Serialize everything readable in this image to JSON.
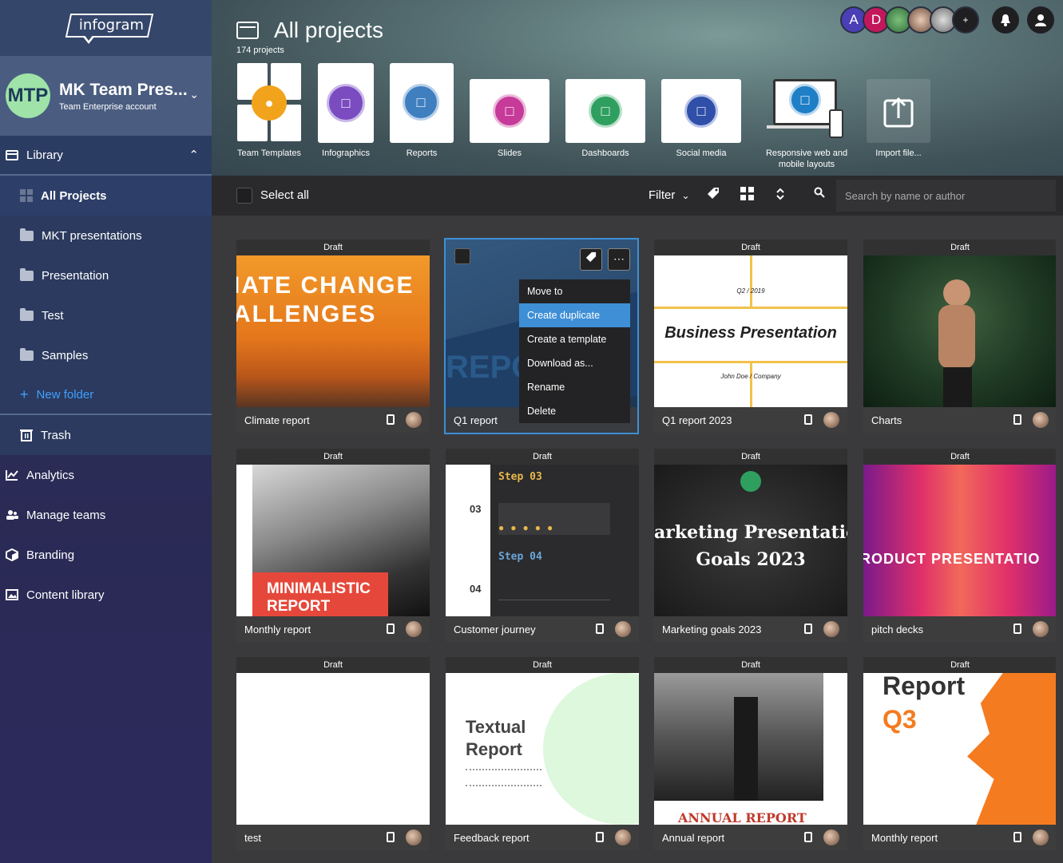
{
  "brand": {
    "logo_text": "infogram"
  },
  "team": {
    "initials": "MTP",
    "name": "MK Team Pres...",
    "account_type": "Team Enterprise account"
  },
  "sidebar": {
    "library_label": "Library",
    "library_items": [
      {
        "label": "All Projects"
      },
      {
        "label": "MKT presentations"
      },
      {
        "label": "Presentation"
      },
      {
        "label": "Test"
      },
      {
        "label": "Samples"
      }
    ],
    "new_folder_label": "New folder",
    "trash_label": "Trash",
    "main_items": [
      {
        "label": "Analytics"
      },
      {
        "label": "Manage teams"
      },
      {
        "label": "Branding"
      },
      {
        "label": "Content library"
      }
    ]
  },
  "header": {
    "title": "All projects",
    "count": "174 projects",
    "templates": [
      {
        "label": "Team Templates"
      },
      {
        "label": "Infographics"
      },
      {
        "label": "Reports"
      },
      {
        "label": "Slides"
      },
      {
        "label": "Dashboards"
      },
      {
        "label": "Social media"
      },
      {
        "label": "Responsive web and mobile layouts"
      },
      {
        "label": "Import file..."
      }
    ],
    "users": [
      {
        "initial": "A",
        "color": "#4a3fb6"
      },
      {
        "initial": "D",
        "color": "#c2185b"
      }
    ]
  },
  "toolbar": {
    "select_all": "Select all",
    "filter": "Filter",
    "search_placeholder": "Search by name or author"
  },
  "projects": [
    {
      "status": "Draft",
      "title": "Climate report",
      "thumb_text": "IATE CHANGE ALLENGES"
    },
    {
      "status": "",
      "title": "Q1 report",
      "thumb_text": "REPOR"
    },
    {
      "status": "Draft",
      "title": "Q1 report 2023",
      "thumb_text": "Business Presentation",
      "thumb_sub1": "Q2 / 2019",
      "thumb_sub2": "John Doe / Company"
    },
    {
      "status": "Draft",
      "title": "Charts",
      "thumb_text": ""
    },
    {
      "status": "Draft",
      "title": "Monthly report",
      "thumb_text": "MINIMALISTIC REPORT"
    },
    {
      "status": "Draft",
      "title": "Customer journey",
      "thumb_text": "Step 03",
      "thumb_sub1": "Step 04",
      "thumb_sub2": "03",
      "thumb_sub3": "04"
    },
    {
      "status": "Draft",
      "title": "Marketing goals 2023",
      "thumb_text": "arketing Presentatio",
      "thumb_sub1": "Goals 2023"
    },
    {
      "status": "Draft",
      "title": "pitch decks",
      "thumb_text": "RODUCT PRESENTATIO"
    },
    {
      "status": "Draft",
      "title": "test",
      "thumb_text": ""
    },
    {
      "status": "Draft",
      "title": "Feedback report",
      "thumb_text": "Textual Report"
    },
    {
      "status": "Draft",
      "title": "Annual report",
      "thumb_text": "ANNUAL REPORT"
    },
    {
      "status": "Draft",
      "title": "Monthly report",
      "thumb_text": "Report",
      "thumb_sub1": "Q3"
    }
  ],
  "context_menu": [
    {
      "label": "Move to"
    },
    {
      "label": "Create duplicate"
    },
    {
      "label": "Create a template"
    },
    {
      "label": "Download as..."
    },
    {
      "label": "Rename"
    },
    {
      "label": "Delete"
    }
  ]
}
